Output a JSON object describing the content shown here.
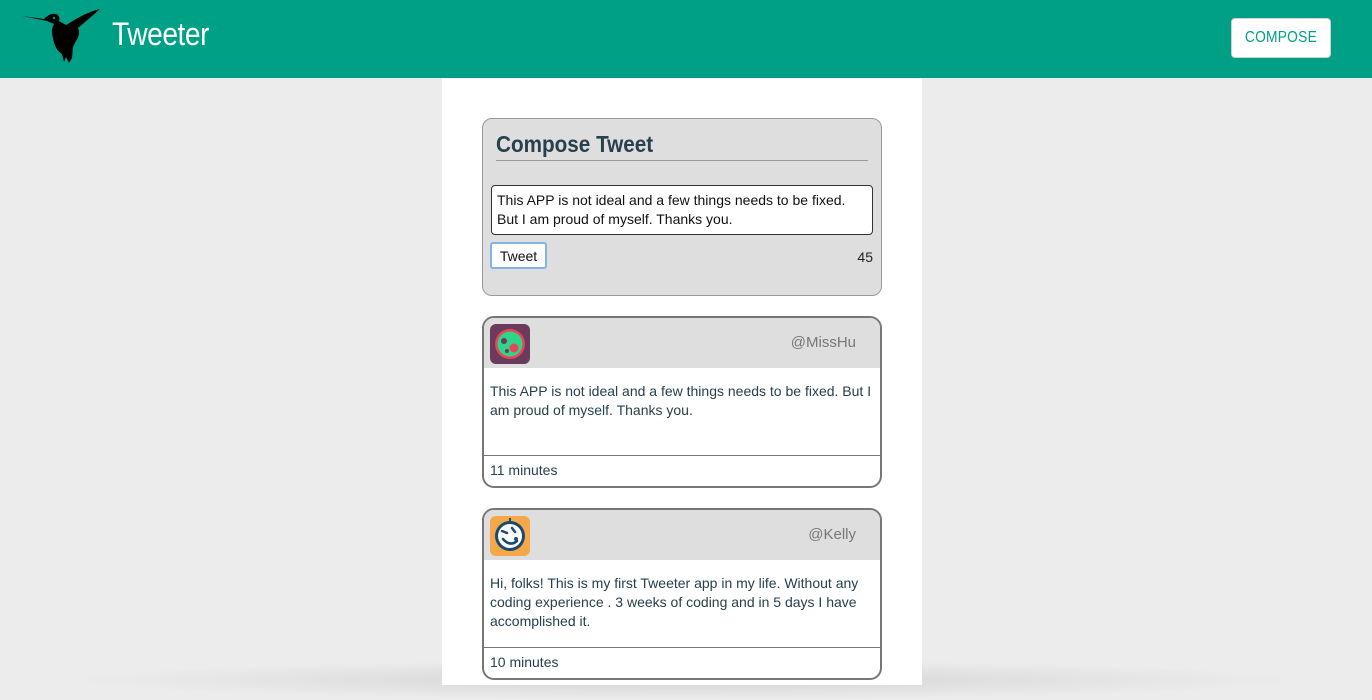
{
  "header": {
    "brand": "Tweeter",
    "compose_label": "COMPOSE"
  },
  "compose": {
    "title": "Compose Tweet",
    "input_value": "This APP is not ideal and a few things needs to be fixed. But I am proud of myself. Thanks you.",
    "tweet_button": "Tweet",
    "counter": "45"
  },
  "tweets": [
    {
      "handle": "@MissHu",
      "text": "This APP is not ideal and a few things needs to be fixed. But I am proud of myself. Thanks you.",
      "time": "11 minutes",
      "avatar": "green-face-avatar-icon"
    },
    {
      "handle": "@Kelly",
      "text": "Hi, folks! This is my first Tweeter app in my life. Without any coding experience . 3 weeks of coding and in 5 days I have accomplished it.",
      "time": "10 minutes",
      "avatar": "blue-face-avatar-icon"
    }
  ],
  "colors": {
    "accent": "#00a087",
    "page_bg": "#ececec",
    "panel_bg": "#dedede",
    "text_dark": "#27404d"
  }
}
